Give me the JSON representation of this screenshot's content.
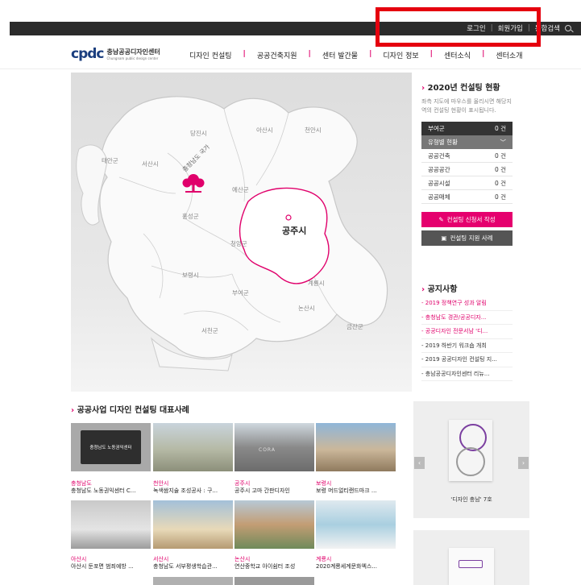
{
  "topbar": {
    "login": "로그인",
    "signup": "회원가입",
    "search": "통합검색"
  },
  "logo": {
    "mark": "cpdc",
    "name_ko": "충남공공디자인센터",
    "name_en": "Chungnam public design center"
  },
  "nav": [
    "디자인 컨설팅",
    "공공건축지원",
    "센터 발간물",
    "디자인 정보",
    "센터소식",
    "센터소개"
  ],
  "map": {
    "labels": [
      "태안군",
      "서산시",
      "당진시",
      "아산시",
      "천안시",
      "예산군",
      "홍성군",
      "청양군",
      "보령시",
      "부여군",
      "논산시",
      "계룡시",
      "서천군",
      "금산군"
    ],
    "center_label": "충청남도 국가",
    "selected_city": "공주시"
  },
  "status": {
    "title": "2020년 컨설팅 현황",
    "desc": "좌측 지도에 마우스를 올리시면 해당지역의 컨설팅 현황이 표시됩니다.",
    "rows": [
      {
        "label": "부여군",
        "value": "0 건"
      },
      {
        "label": "유형별 현황",
        "value": "﹀"
      },
      {
        "label": "공공건축",
        "value": "0 건"
      },
      {
        "label": "공공공간",
        "value": "0 건"
      },
      {
        "label": "공공시설",
        "value": "0 건"
      },
      {
        "label": "공공매체",
        "value": "0 건"
      }
    ],
    "btn_apply": "컨설팅 신청서 작성",
    "btn_cases": "컨설팅 지원 사례"
  },
  "notice": {
    "title": "공지사항",
    "items": [
      "- 2019 정책연구 성과 알림",
      "- 충청남도 경관/공공디자...",
      "- 공공디자인 전문서남 '디...",
      "- 2019 하반기 워크숍 개최",
      "- 2019 공공디자인 컨설팅 지...",
      "- 충남공공디자인센터 리뉴..."
    ]
  },
  "cases": {
    "title": "공공사업 디자인 컨설팅 대표사례",
    "items": [
      {
        "region": "충청남도",
        "name": "충청남도 노동권익센터 C..."
      },
      {
        "region": "천안시",
        "name": "녹색쌈지술 조성공사 : 구..."
      },
      {
        "region": "공주시",
        "name": "공주시 고마 간판디자인"
      },
      {
        "region": "보령시",
        "name": "보령 머드얼티랜드마크 ..."
      },
      {
        "region": "아산시",
        "name": "아산시 둔포면 범죄예방 ..."
      },
      {
        "region": "서산시",
        "name": "충청남도 서부평생학습관..."
      },
      {
        "region": "논산시",
        "name": "연산중학교 아이쉼터 조성"
      },
      {
        "region": "계룡시",
        "name": "2020계룡세계문화엑스..."
      }
    ],
    "tile_sign_text": "충청남도 노동권익센터",
    "tile_wall_text": "CORA"
  },
  "promo": {
    "caption": "'디자인 충남' 7호"
  },
  "colors": {
    "accent": "#e0006b",
    "brand": "#1c3f7f",
    "topbar": "#2b2b2b"
  }
}
